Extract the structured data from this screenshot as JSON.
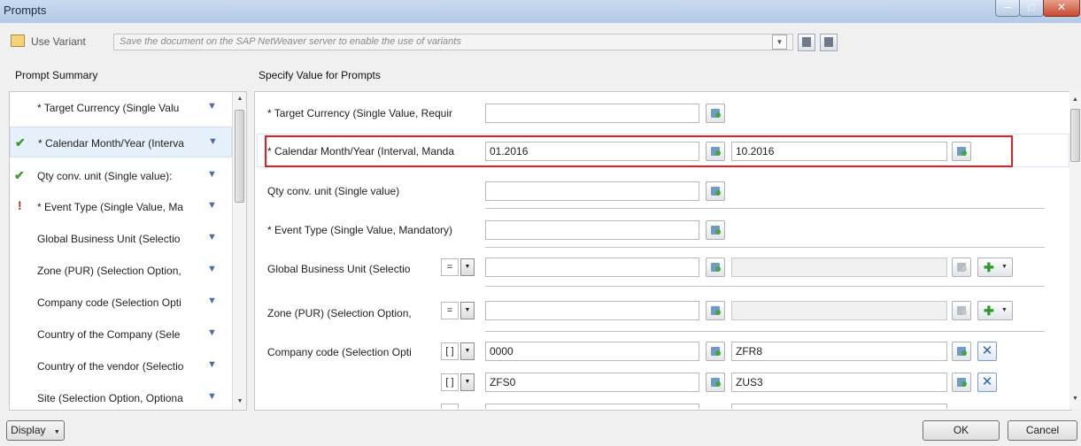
{
  "window": {
    "title": "Prompts"
  },
  "variant": {
    "label": "Use Variant",
    "placeholder": "Save the document on the SAP NetWeaver server to enable the use of variants"
  },
  "left": {
    "header": "Prompt Summary",
    "items": [
      {
        "label": "* Target Currency (Single Valu",
        "status": "none"
      },
      {
        "label": "* Calendar Month/Year (Interva",
        "status": "ok"
      },
      {
        "label": "Qty conv. unit (Single value):",
        "status": "ok"
      },
      {
        "label": "* Event Type (Single Value, Ma",
        "status": "error"
      },
      {
        "label": "Global Business Unit (Selectio",
        "status": "none"
      },
      {
        "label": "Zone (PUR) (Selection Option,",
        "status": "none"
      },
      {
        "label": "Company code (Selection Opti",
        "status": "none"
      },
      {
        "label": "Country of the Company (Sele",
        "status": "none"
      },
      {
        "label": "Country of the vendor (Selectio",
        "status": "none"
      },
      {
        "label": "Site (Selection Option, Optiona",
        "status": "none"
      }
    ]
  },
  "right": {
    "header": "Specify Value for Prompts",
    "target_currency": {
      "label": "* Target Currency (Single Value, Requir",
      "value": ""
    },
    "calendar": {
      "label": "* Calendar  Month/Year (Interval, Manda",
      "from": "01.2016",
      "to": "10.2016"
    },
    "qty": {
      "label": "Qty conv. unit (Single value)",
      "value": ""
    },
    "event": {
      "label": "* Event Type (Single Value, Mandatory)",
      "value": ""
    },
    "gbu": {
      "label": "Global Business Unit (Selectio",
      "operator": "=",
      "from": "",
      "to": ""
    },
    "zone": {
      "label": "Zone (PUR) (Selection Option,",
      "operator": "=",
      "from": "",
      "to": ""
    },
    "company": {
      "label": "Company code  (Selection Opti",
      "rows": [
        {
          "operator": "[ ]",
          "from": "0000",
          "to": "ZFR8"
        },
        {
          "operator": "[ ]",
          "from": "ZFS0",
          "to": "ZUS3"
        }
      ]
    }
  },
  "footer": {
    "display": "Display",
    "ok": "OK",
    "cancel": "Cancel"
  }
}
